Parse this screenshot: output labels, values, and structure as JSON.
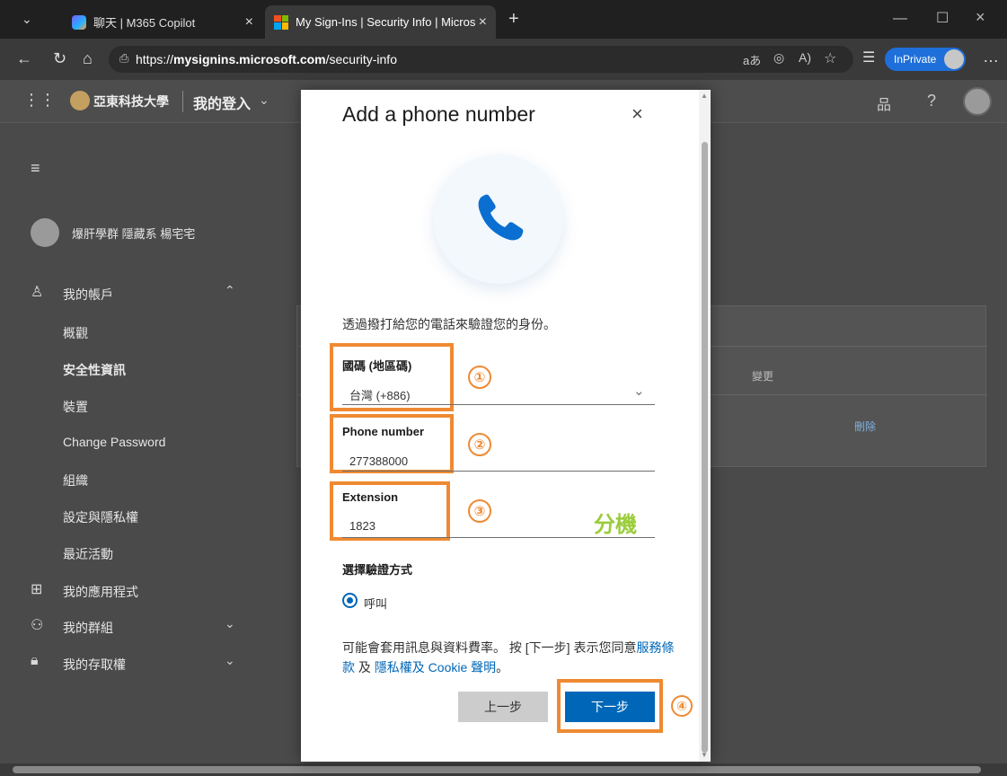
{
  "browser": {
    "tabs": [
      {
        "title": "聊天 | M365 Copilot"
      },
      {
        "title": "My Sign-Ins | Security Info | Micros"
      }
    ],
    "new_tab": "+",
    "url_prefix": "https://",
    "url_host": "mysignins.microsoft.com",
    "url_path": "/security-info",
    "inprivate": "InPrivate"
  },
  "header": {
    "org_name": "亞東科技大學",
    "app_name": "我的登入",
    "help": "?"
  },
  "sidebar": {
    "user_name": "爆肝學群 隱藏系 楊宅宅",
    "my_account": "我的帳戶",
    "items": [
      "概觀",
      "安全性資訊",
      "裝置",
      "Change Password",
      "組織",
      "設定與隱私權",
      "最近活動"
    ],
    "my_apps": "我的應用程式",
    "my_groups": "我的群組",
    "my_access": "我的存取權"
  },
  "content": {
    "change": "變更",
    "delete": "刪除"
  },
  "dialog": {
    "title": "Add a phone number",
    "close": "×",
    "description": "透過撥打給您的電話來驗證您的身份。",
    "country_label": "國碼 (地區碼)",
    "country_value": "台灣 (+886)",
    "phone_label": "Phone number",
    "phone_value": "277388000",
    "extension_label": "Extension",
    "extension_value": "1823",
    "extension_note": "分機",
    "method_label": "選擇驗證方式",
    "method_option": "呼叫",
    "terms_prefix": "可能會套用訊息與資料費率。 按 [下一步] 表示您同意",
    "terms_link1": "服務條款",
    "terms_mid": " 及 ",
    "terms_link2": "隱私權及 Cookie 聲明",
    "terms_suffix": "。",
    "back_button": "上一步",
    "next_button": "下一步"
  },
  "annotations": [
    "①",
    "②",
    "③",
    "④"
  ],
  "colors": {
    "accent": "#0067b8",
    "annotation": "#ef8a32",
    "extension_note": "#9bcc3b",
    "inprivate": "#1e6fd9"
  }
}
